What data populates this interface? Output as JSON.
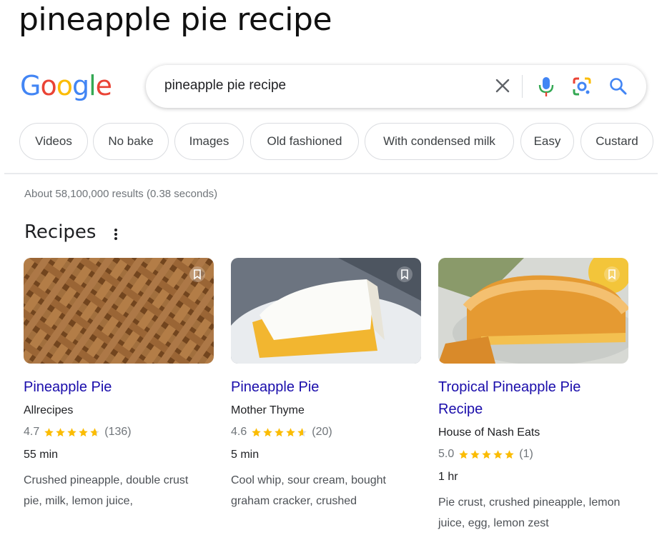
{
  "headline": "pineapple pie recipe",
  "logo": {
    "letters": [
      "G",
      "o",
      "o",
      "g",
      "l",
      "e"
    ],
    "colors": [
      "#4285F4",
      "#EA4335",
      "#FBBC05",
      "#4285F4",
      "#34A853",
      "#EA4335"
    ]
  },
  "search": {
    "query": "pineapple pie recipe"
  },
  "chips": [
    "Videos",
    "No bake",
    "Images",
    "Old fashioned",
    "With condensed milk",
    "Easy",
    "Custard"
  ],
  "stats": "About 58,100,000 results (0.38 seconds)",
  "recipes_title": "Recipes",
  "colors": {
    "link": "#1a0dab",
    "star": "#fbbc04",
    "muted": "#70757a"
  },
  "recipes": [
    {
      "title": "Pineapple Pie",
      "source": "Allrecipes",
      "rating": "4.7",
      "stars": 4.7,
      "count": "(136)",
      "time": "55 min",
      "ingredients": "Crushed pineapple, double crust pie, milk, lemon juice,"
    },
    {
      "title": "Pineapple Pie",
      "source": "Mother Thyme",
      "rating": "4.6",
      "stars": 4.6,
      "count": "(20)",
      "time": "5 min",
      "ingredients": "Cool whip, sour cream, bought graham cracker, crushed"
    },
    {
      "title": "Tropical Pineapple Pie Recipe",
      "source": "House of Nash Eats",
      "rating": "5.0",
      "stars": 5.0,
      "count": "(1)",
      "time": "1 hr",
      "ingredients": "Pie crust, crushed pineapple, lemon juice, egg, lemon zest"
    }
  ]
}
